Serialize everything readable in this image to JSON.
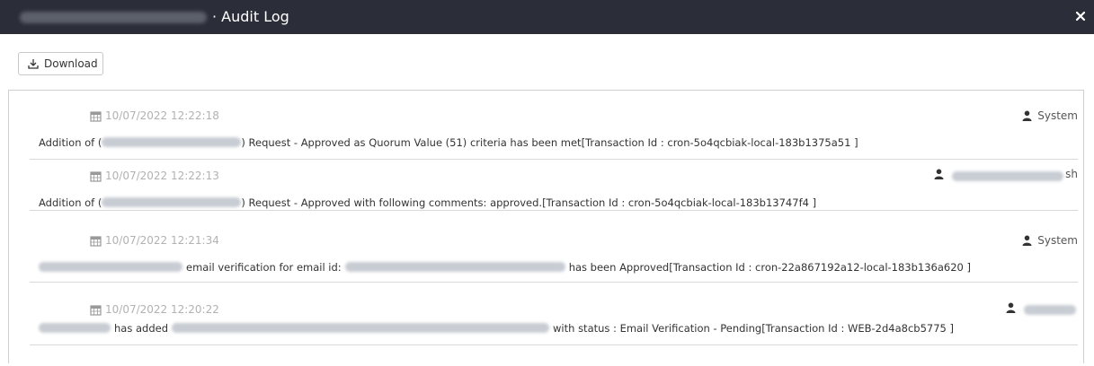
{
  "header": {
    "title": "· Audit Log",
    "close_label": "×"
  },
  "toolbar": {
    "download_label": "Download"
  },
  "icons": {
    "calendar": "calendar-icon",
    "user": "user-icon",
    "download": "download-icon",
    "close": "close-icon"
  },
  "colors": {
    "header_bg": "#2b2e38",
    "date_text": "#b2b2b2",
    "border": "#d9d9d9"
  },
  "entries": [
    {
      "date": "10/07/2022 12:22:18",
      "user": "System",
      "msg_part1": "Addition of (",
      "msg_part2": ") Request - Approved as Quorum Value (51) criteria has been met[Transaction Id : cron-5o4qcbiak-local-183b1375a51 ]"
    },
    {
      "date": "10/07/2022 12:22:13",
      "user_suffix": "sh",
      "msg_part1": "Addition of (",
      "msg_part2": ") Request - Approved with following comments: approved.[Transaction Id : cron-5o4qcbiak-local-183b13747f4 ]"
    },
    {
      "date": "10/07/2022 12:21:34",
      "user": "System",
      "msg_part1": "email verification for email id:",
      "msg_part2": "has been Approved[Transaction Id : cron-22a867192a12-local-183b136a620 ]"
    },
    {
      "date": "10/07/2022 12:20:22",
      "msg_part1": "has added",
      "msg_part2": "with status : Email Verification - Pending[Transaction Id : WEB-2d4a8cb5775 ]"
    }
  ]
}
